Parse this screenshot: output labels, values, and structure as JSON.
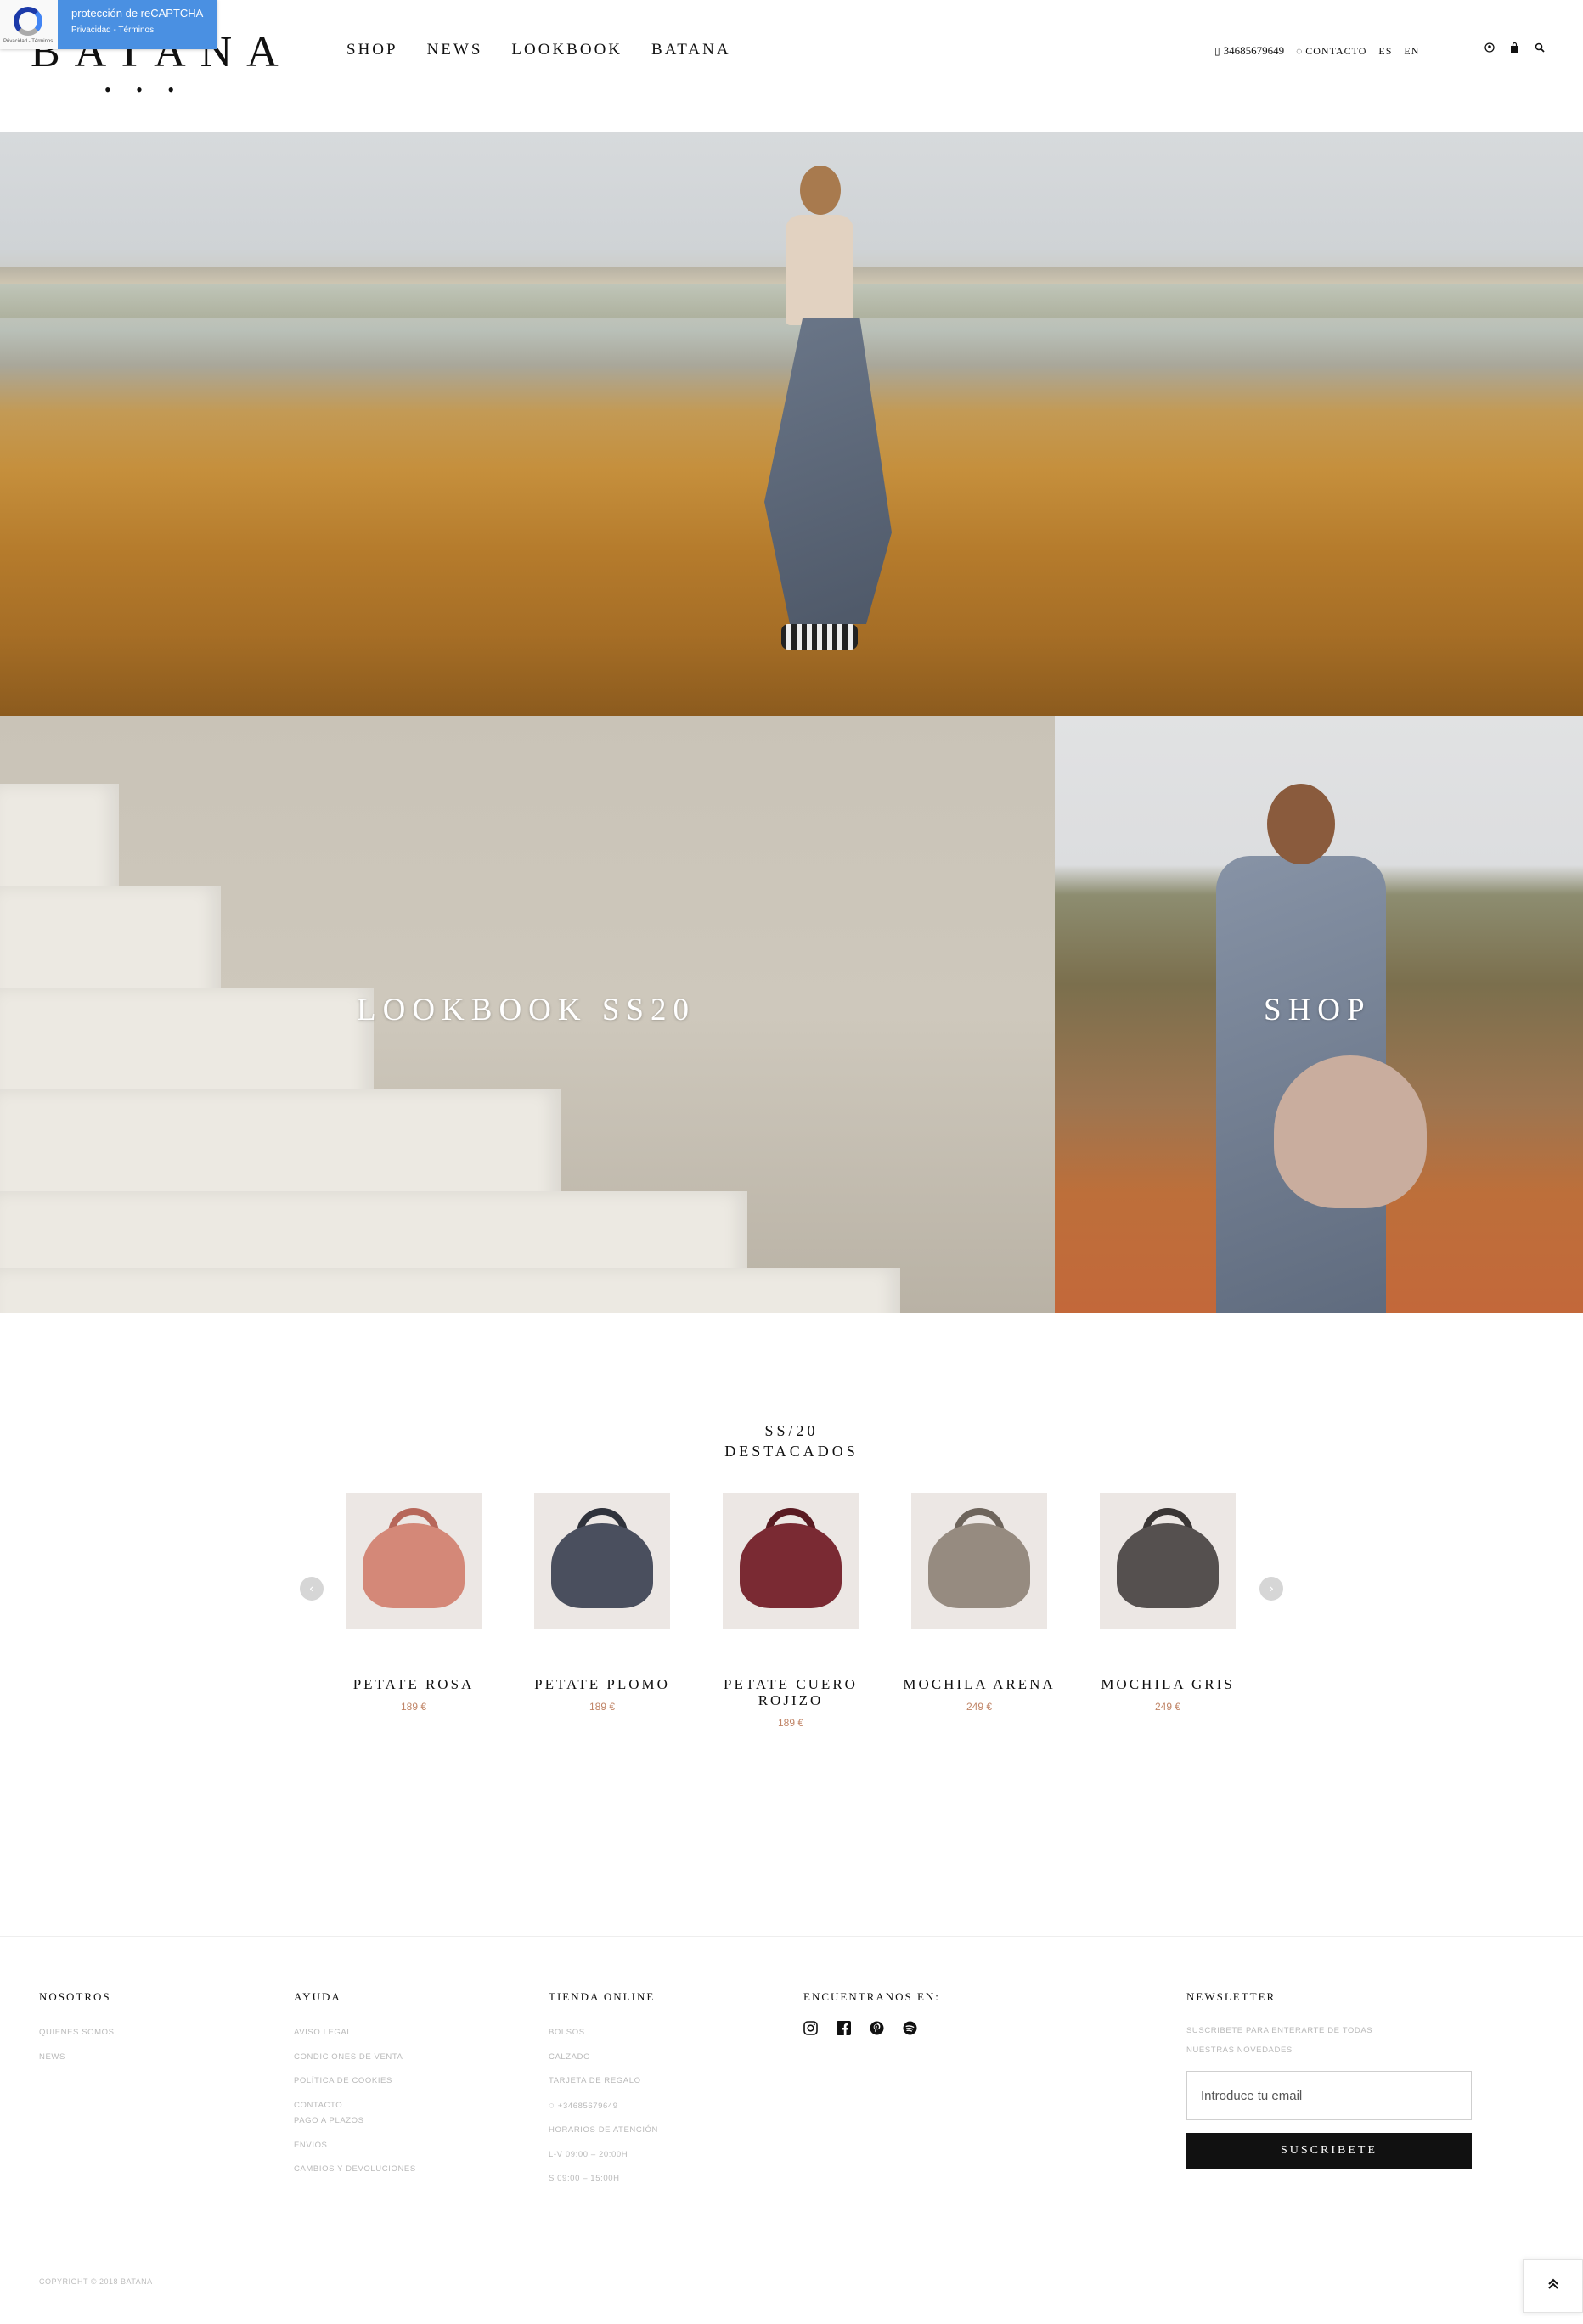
{
  "recaptcha": {
    "title": "protección de reCAPTCHA",
    "links": "Privacidad - Términos",
    "mini": "Privacidad - Términos"
  },
  "header": {
    "logo_text": "BATANA",
    "logo_dots": "• • •",
    "nav": [
      {
        "label": "SHOP"
      },
      {
        "label": "NEWS"
      },
      {
        "label": "LOOKBOOK"
      },
      {
        "label": "BATANA"
      }
    ],
    "phone": "34685679649",
    "contact": "CONTACTO",
    "lang_es": "ES",
    "lang_en": "EN",
    "icons": [
      "user-icon",
      "bag-icon",
      "search-icon"
    ]
  },
  "tiles": {
    "left_label": "LOOKBOOK SS20",
    "right_label": "SHOP"
  },
  "featured": {
    "line1": "SS/20",
    "line2": "DESTACADOS",
    "prev": "‹",
    "next": "›"
  },
  "products": [
    {
      "name": "PETATE ROSA",
      "price": "189 €",
      "color": "#d48878"
    },
    {
      "name": "PETATE PLOMO",
      "price": "189 €",
      "color": "#4a4f5e"
    },
    {
      "name": "PETATE CUERO ROJIZO",
      "price": "189 €",
      "color": "#7a2a33"
    },
    {
      "name": "MOCHILA ARENA",
      "price": "249 €",
      "color": "#968b80"
    },
    {
      "name": "MOCHILA GRIS",
      "price": "249 €",
      "color": "#55504f"
    }
  ],
  "footer": {
    "nosotros": {
      "title": "NOSOTROS",
      "links": [
        "QUIENES SOMOS",
        "NEWS"
      ]
    },
    "ayuda": {
      "title": "AYUDA",
      "links": [
        "AVISO LEGAL",
        "CONDICIONES DE VENTA",
        "POLÍTICA DE COOKIES",
        "CONTACTO",
        "PAGO A PLAZOS",
        "ENVIOS",
        "CAMBIOS Y DEVOLUCIONES"
      ]
    },
    "tienda": {
      "title": "TIENDA ONLINE",
      "links": [
        "BOLSOS",
        "CALZADO",
        "TARJETA DE REGALO",
        "+34685679649",
        "HORARIOS DE ATENCIÓN",
        "L-V 09:00 – 20:00H",
        "S 09:00 – 15:00H"
      ]
    },
    "social": {
      "title": "ENCUENTRANOS EN:",
      "icons": [
        "instagram-icon",
        "facebook-icon",
        "pinterest-icon",
        "spotify-icon"
      ]
    },
    "newsletter": {
      "title": "NEWSLETTER",
      "text1": "SUSCRIBETE PARA ENTERARTE DE TODAS",
      "text2": "NUESTRAS NOVEDADES",
      "placeholder": "Introduce tu email",
      "button": "SUSCRIBETE"
    },
    "copyright": "COPYRIGHT © 2018 BATANA"
  }
}
